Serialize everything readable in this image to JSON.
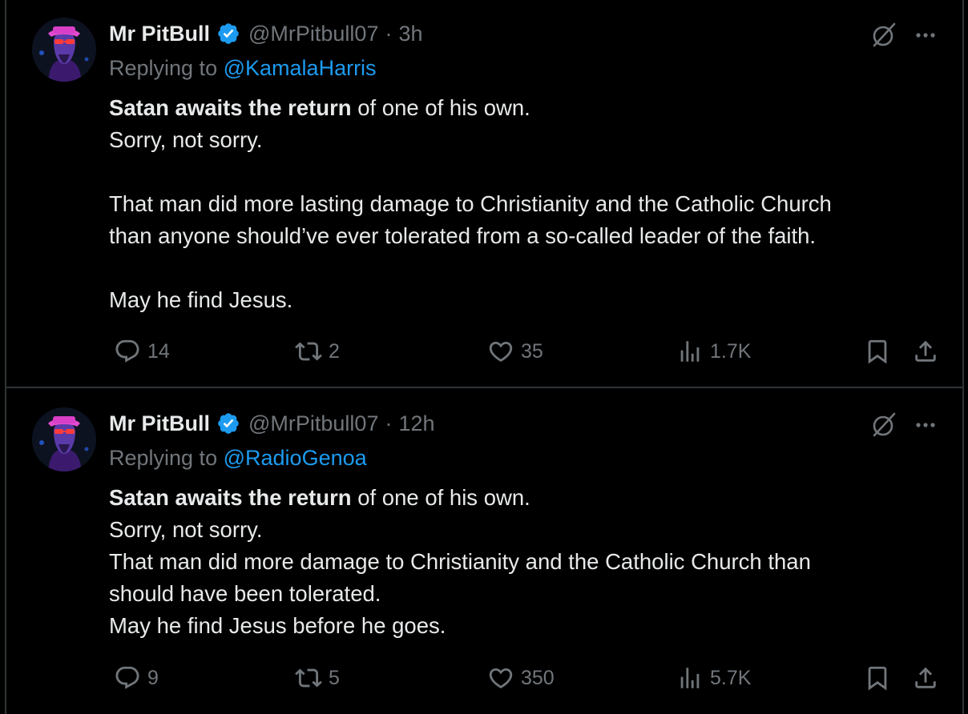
{
  "tweets": [
    {
      "display_name": "Mr PitBull",
      "handle": "@MrPitbull07",
      "separator": "·",
      "time": "3h",
      "replying_prefix": "Replying to",
      "replying_to": "@KamalaHarris",
      "lines": [
        {
          "bold": "Satan awaits the return",
          "text": " of one of his own."
        },
        {
          "bold": "",
          "text": "Sorry, not sorry."
        },
        {
          "bold": "",
          "text": ""
        },
        {
          "bold": "",
          "text": "That man did more lasting damage to Christianity and the Catholic Church"
        },
        {
          "bold": "",
          "text": "than anyone should’ve ever tolerated from a so-called leader of the faith."
        },
        {
          "bold": "",
          "text": ""
        },
        {
          "bold": "",
          "text": "May he find Jesus."
        }
      ],
      "stats": {
        "replies": "14",
        "reposts": "2",
        "likes": "35",
        "views": "1.7K"
      }
    },
    {
      "display_name": "Mr PitBull",
      "handle": "@MrPitbull07",
      "separator": "·",
      "time": "12h",
      "replying_prefix": "Replying to",
      "replying_to": "@RadioGenoa",
      "lines": [
        {
          "bold": "Satan awaits the return",
          "text": " of one of his own."
        },
        {
          "bold": "",
          "text": "Sorry, not sorry."
        },
        {
          "bold": "",
          "text": "That man did more damage to Christianity and the Catholic Church than"
        },
        {
          "bold": "",
          "text": "should have been tolerated."
        },
        {
          "bold": "",
          "text": "May he find Jesus before he goes."
        }
      ],
      "stats": {
        "replies": "9",
        "reposts": "5",
        "likes": "350",
        "views": "5.7K"
      }
    }
  ],
  "icons": {
    "verified": "verified-badge-icon",
    "grok": "grok-icon",
    "more": "more-icon",
    "reply": "reply-icon",
    "repost": "repost-icon",
    "like": "like-icon",
    "views": "views-icon",
    "bookmark": "bookmark-icon",
    "share": "share-icon"
  },
  "colors": {
    "background": "#000000",
    "text": "#e7e9ea",
    "secondary": "#71767b",
    "link": "#1d9bf0",
    "verified": "#1d9bf0",
    "border": "#2f3336"
  }
}
